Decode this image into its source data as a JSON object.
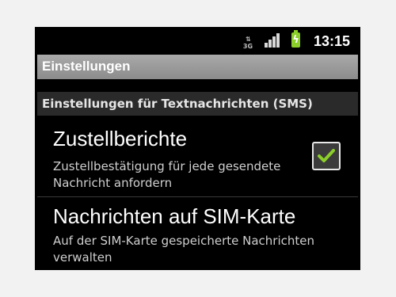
{
  "status_bar": {
    "network_type": "3G",
    "network_arrows": "⇅",
    "time": "13:15",
    "battery_charging": true,
    "signal_bars": 4
  },
  "title_bar": {
    "title": "Einstellungen"
  },
  "category": {
    "label": "Einstellungen für Textnachrichten (SMS)"
  },
  "preferences": [
    {
      "title": "Zustellberichte",
      "summary": "Zustellbestätigung für jede gesendete Nachricht anfordern",
      "checked": true
    },
    {
      "title": "Nachrichten auf SIM-Karte",
      "summary": "Auf der SIM-Karte gespeicherte Nachrichten verwalten"
    }
  ],
  "colors": {
    "checkmark": "#8ccf2a",
    "battery": "#8ccf2a",
    "background": "#000000"
  }
}
